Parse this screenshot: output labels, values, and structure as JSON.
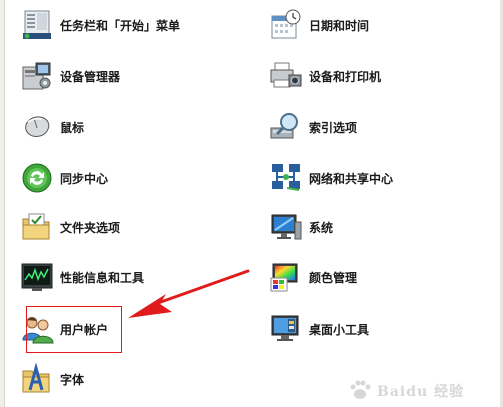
{
  "colors": {
    "annotation": "#e01b1b",
    "text": "#1a1a1a",
    "background": "#ffffff"
  },
  "left_column": [
    {
      "label": "任务栏和「开始」菜单",
      "icon": "taskbar-icon"
    },
    {
      "label": "设备管理器",
      "icon": "device-manager-icon"
    },
    {
      "label": "鼠标",
      "icon": "mouse-icon"
    },
    {
      "label": "同步中心",
      "icon": "sync-center-icon"
    },
    {
      "label": "文件夹选项",
      "icon": "folder-options-icon"
    },
    {
      "label": "性能信息和工具",
      "icon": "performance-icon"
    },
    {
      "label": "用户帐户",
      "icon": "user-accounts-icon"
    },
    {
      "label": "字体",
      "icon": "fonts-icon"
    }
  ],
  "right_column": [
    {
      "label": "日期和时间",
      "icon": "date-time-icon"
    },
    {
      "label": "设备和打印机",
      "icon": "devices-printers-icon"
    },
    {
      "label": "索引选项",
      "icon": "indexing-options-icon"
    },
    {
      "label": "网络和共享中心",
      "icon": "network-sharing-icon"
    },
    {
      "label": "系统",
      "icon": "system-icon"
    },
    {
      "label": "颜色管理",
      "icon": "color-management-icon"
    },
    {
      "label": "桌面小工具",
      "icon": "desktop-gadgets-icon"
    }
  ],
  "watermark": {
    "text": "Baidu 经验"
  }
}
